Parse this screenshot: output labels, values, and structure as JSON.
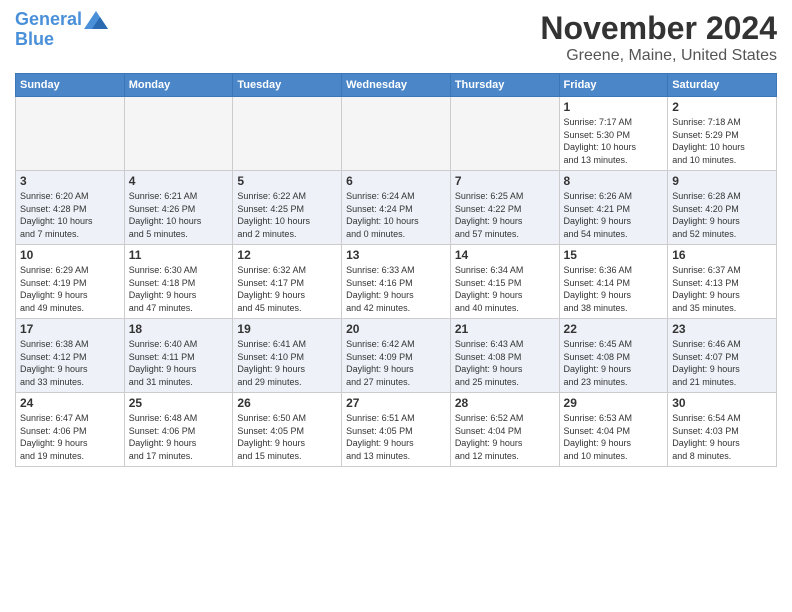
{
  "header": {
    "logo_line1": "General",
    "logo_line2": "Blue",
    "month": "November 2024",
    "location": "Greene, Maine, United States"
  },
  "weekdays": [
    "Sunday",
    "Monday",
    "Tuesday",
    "Wednesday",
    "Thursday",
    "Friday",
    "Saturday"
  ],
  "weeks": [
    [
      {
        "day": "",
        "info": ""
      },
      {
        "day": "",
        "info": ""
      },
      {
        "day": "",
        "info": ""
      },
      {
        "day": "",
        "info": ""
      },
      {
        "day": "",
        "info": ""
      },
      {
        "day": "1",
        "info": "Sunrise: 7:17 AM\nSunset: 5:30 PM\nDaylight: 10 hours\nand 13 minutes."
      },
      {
        "day": "2",
        "info": "Sunrise: 7:18 AM\nSunset: 5:29 PM\nDaylight: 10 hours\nand 10 minutes."
      }
    ],
    [
      {
        "day": "3",
        "info": "Sunrise: 6:20 AM\nSunset: 4:28 PM\nDaylight: 10 hours\nand 7 minutes."
      },
      {
        "day": "4",
        "info": "Sunrise: 6:21 AM\nSunset: 4:26 PM\nDaylight: 10 hours\nand 5 minutes."
      },
      {
        "day": "5",
        "info": "Sunrise: 6:22 AM\nSunset: 4:25 PM\nDaylight: 10 hours\nand 2 minutes."
      },
      {
        "day": "6",
        "info": "Sunrise: 6:24 AM\nSunset: 4:24 PM\nDaylight: 10 hours\nand 0 minutes."
      },
      {
        "day": "7",
        "info": "Sunrise: 6:25 AM\nSunset: 4:22 PM\nDaylight: 9 hours\nand 57 minutes."
      },
      {
        "day": "8",
        "info": "Sunrise: 6:26 AM\nSunset: 4:21 PM\nDaylight: 9 hours\nand 54 minutes."
      },
      {
        "day": "9",
        "info": "Sunrise: 6:28 AM\nSunset: 4:20 PM\nDaylight: 9 hours\nand 52 minutes."
      }
    ],
    [
      {
        "day": "10",
        "info": "Sunrise: 6:29 AM\nSunset: 4:19 PM\nDaylight: 9 hours\nand 49 minutes."
      },
      {
        "day": "11",
        "info": "Sunrise: 6:30 AM\nSunset: 4:18 PM\nDaylight: 9 hours\nand 47 minutes."
      },
      {
        "day": "12",
        "info": "Sunrise: 6:32 AM\nSunset: 4:17 PM\nDaylight: 9 hours\nand 45 minutes."
      },
      {
        "day": "13",
        "info": "Sunrise: 6:33 AM\nSunset: 4:16 PM\nDaylight: 9 hours\nand 42 minutes."
      },
      {
        "day": "14",
        "info": "Sunrise: 6:34 AM\nSunset: 4:15 PM\nDaylight: 9 hours\nand 40 minutes."
      },
      {
        "day": "15",
        "info": "Sunrise: 6:36 AM\nSunset: 4:14 PM\nDaylight: 9 hours\nand 38 minutes."
      },
      {
        "day": "16",
        "info": "Sunrise: 6:37 AM\nSunset: 4:13 PM\nDaylight: 9 hours\nand 35 minutes."
      }
    ],
    [
      {
        "day": "17",
        "info": "Sunrise: 6:38 AM\nSunset: 4:12 PM\nDaylight: 9 hours\nand 33 minutes."
      },
      {
        "day": "18",
        "info": "Sunrise: 6:40 AM\nSunset: 4:11 PM\nDaylight: 9 hours\nand 31 minutes."
      },
      {
        "day": "19",
        "info": "Sunrise: 6:41 AM\nSunset: 4:10 PM\nDaylight: 9 hours\nand 29 minutes."
      },
      {
        "day": "20",
        "info": "Sunrise: 6:42 AM\nSunset: 4:09 PM\nDaylight: 9 hours\nand 27 minutes."
      },
      {
        "day": "21",
        "info": "Sunrise: 6:43 AM\nSunset: 4:08 PM\nDaylight: 9 hours\nand 25 minutes."
      },
      {
        "day": "22",
        "info": "Sunrise: 6:45 AM\nSunset: 4:08 PM\nDaylight: 9 hours\nand 23 minutes."
      },
      {
        "day": "23",
        "info": "Sunrise: 6:46 AM\nSunset: 4:07 PM\nDaylight: 9 hours\nand 21 minutes."
      }
    ],
    [
      {
        "day": "24",
        "info": "Sunrise: 6:47 AM\nSunset: 4:06 PM\nDaylight: 9 hours\nand 19 minutes."
      },
      {
        "day": "25",
        "info": "Sunrise: 6:48 AM\nSunset: 4:06 PM\nDaylight: 9 hours\nand 17 minutes."
      },
      {
        "day": "26",
        "info": "Sunrise: 6:50 AM\nSunset: 4:05 PM\nDaylight: 9 hours\nand 15 minutes."
      },
      {
        "day": "27",
        "info": "Sunrise: 6:51 AM\nSunset: 4:05 PM\nDaylight: 9 hours\nand 13 minutes."
      },
      {
        "day": "28",
        "info": "Sunrise: 6:52 AM\nSunset: 4:04 PM\nDaylight: 9 hours\nand 12 minutes."
      },
      {
        "day": "29",
        "info": "Sunrise: 6:53 AM\nSunset: 4:04 PM\nDaylight: 9 hours\nand 10 minutes."
      },
      {
        "day": "30",
        "info": "Sunrise: 6:54 AM\nSunset: 4:03 PM\nDaylight: 9 hours\nand 8 minutes."
      }
    ]
  ]
}
